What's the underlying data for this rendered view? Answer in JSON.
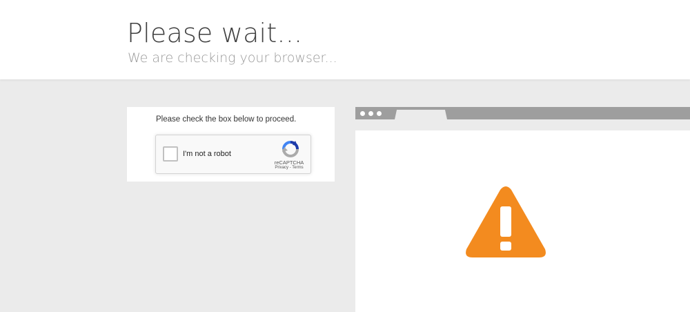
{
  "header": {
    "title": "Please wait...",
    "subtitle": "We are checking your browser..."
  },
  "captcha": {
    "instruction": "Please check the box below to proceed.",
    "checkbox_label": "I'm not a robot",
    "checked": false,
    "brand": "reCAPTCHA",
    "privacy_link": "Privacy",
    "separator": " - ",
    "terms_link": "Terms"
  },
  "illustration": {
    "icon": "warning-icon",
    "color": "#f38b1f"
  },
  "colors": {
    "background": "#ebebeb",
    "panel": "#ffffff",
    "browser_bar": "#9e9e9e",
    "warning": "#f38b1f"
  }
}
